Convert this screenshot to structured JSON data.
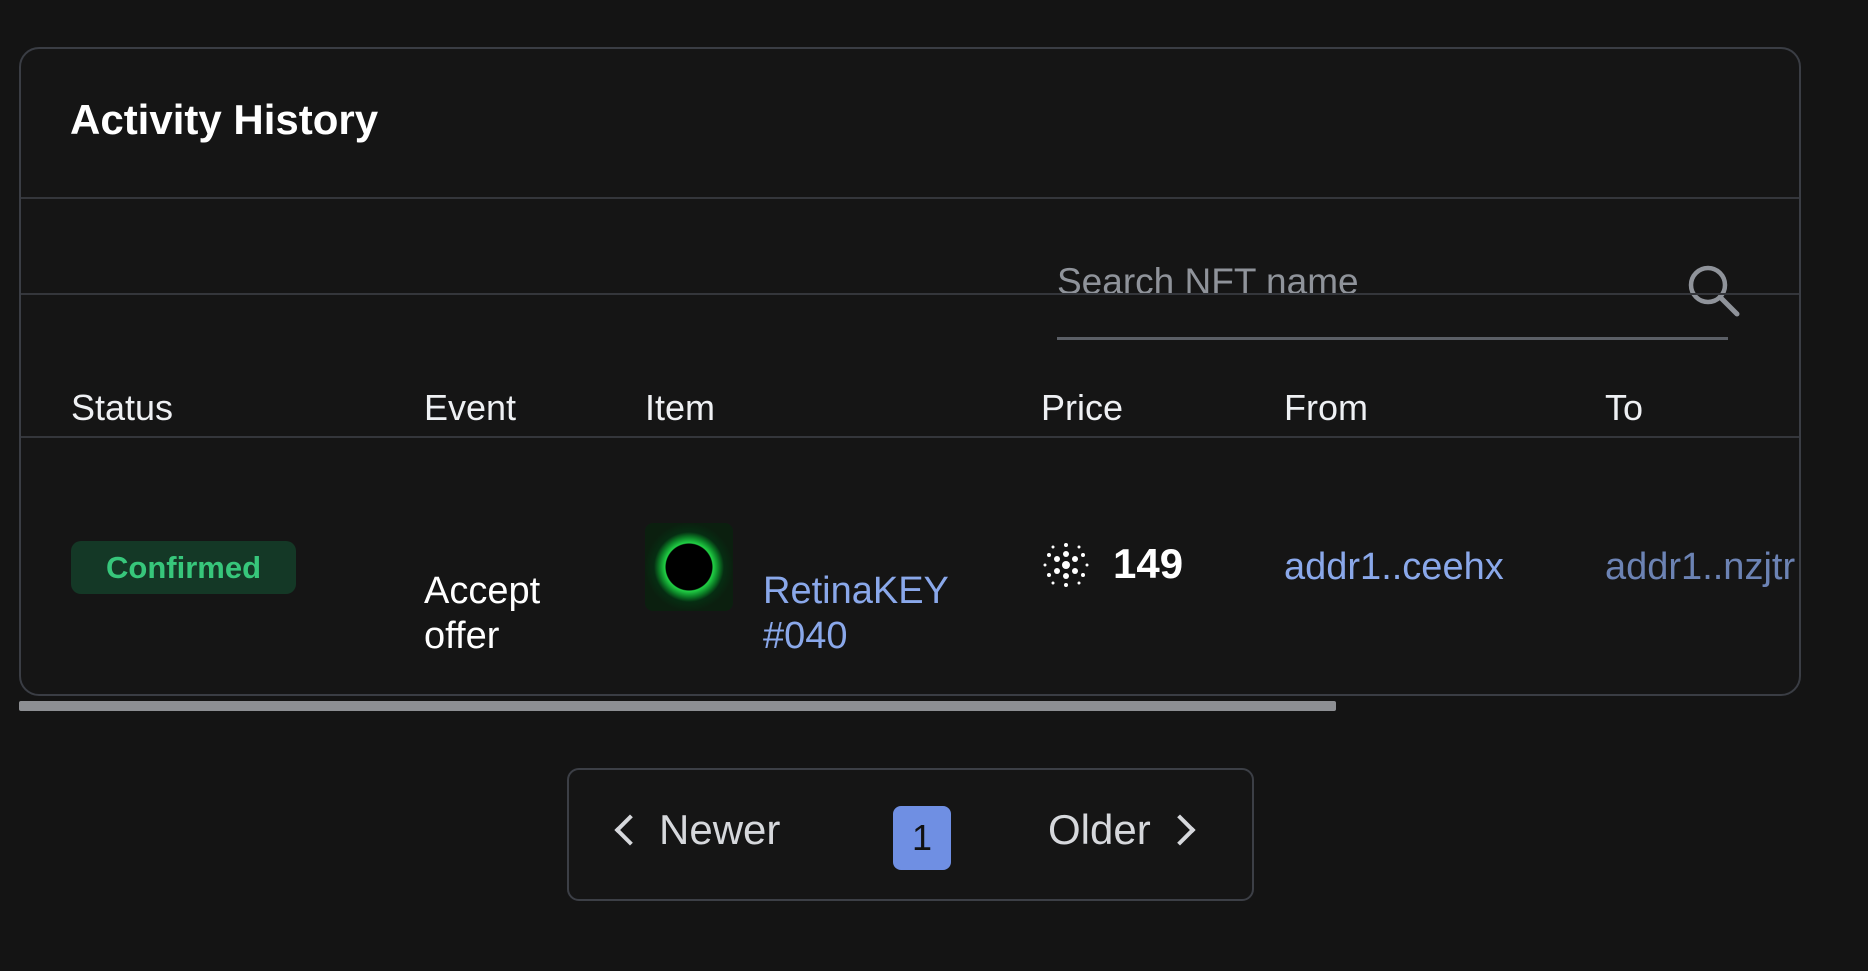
{
  "activity": {
    "title": "Activity History",
    "search": {
      "placeholder": "Search NFT name",
      "value": ""
    },
    "table": {
      "headers": [
        "Status",
        "Event",
        "Item",
        "Price",
        "From",
        "To"
      ],
      "rows": [
        {
          "status": "Confirmed",
          "event": "Accept offer",
          "item": "RetinaKEY #040",
          "price": "149",
          "from": "addr1..ceehx",
          "to": "addr1..nzjtr"
        }
      ]
    },
    "icons": {
      "search": "search-icon",
      "currency": "cardano-icon",
      "previous": "chevron-left-icon",
      "next": "chevron-right-icon"
    },
    "colors": {
      "accent": "#6f8fe3",
      "link": "#8aa8ea",
      "status_bg": "#143826",
      "status_text": "#37c67b"
    }
  },
  "pagination": {
    "newer": "Newer",
    "older": "Older",
    "current_page": "1"
  },
  "table_scroll": {
    "thumb_fraction": 0.74
  }
}
